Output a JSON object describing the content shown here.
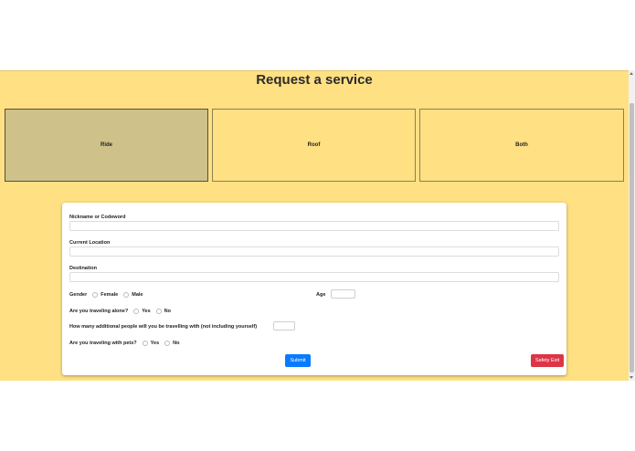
{
  "page": {
    "title": "Request a service"
  },
  "services": {
    "ride": "Ride",
    "roof": "Roof",
    "both": "Both"
  },
  "form": {
    "nickname_label": "Nickname or Codeword",
    "location_label": "Current Location",
    "destination_label": "Destination",
    "gender_label": "Gender",
    "gender_female": "Female",
    "gender_male": "Male",
    "age_label": "Age",
    "alone_label": "Are you traveling alone?",
    "alone_yes": "Yes",
    "alone_no": "No",
    "additional_label": "How many additional people will you be travelling with (not including yourself)",
    "pets_label": "Are you traveling with pets?",
    "pets_yes": "Yes",
    "pets_no": "No",
    "submit_label": "Submit",
    "safety_exit_label": "Safety Exit"
  },
  "colors": {
    "background": "#ffe083",
    "selected_card": "#cfc18a",
    "submit": "#0a7bff",
    "safety_exit": "#dc3545"
  }
}
